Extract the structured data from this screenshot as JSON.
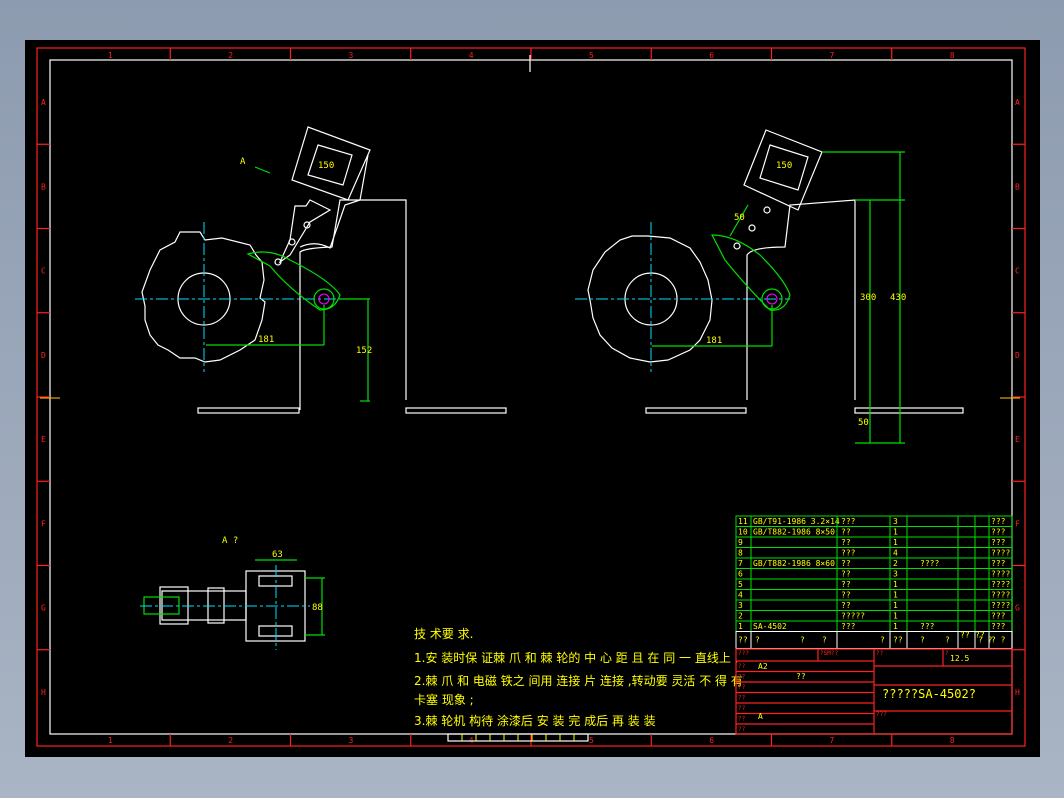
{
  "zones": {
    "cols": [
      "1",
      "2",
      "3",
      "4",
      "5",
      "6",
      "7",
      "8"
    ],
    "rows": [
      "A",
      "B",
      "C",
      "D",
      "E",
      "F",
      "G",
      "H"
    ]
  },
  "views": {
    "view_arrow_label": "A",
    "left_dims": {
      "horizontal": "181",
      "vertical": "152",
      "magnet": "150"
    },
    "right_dims": {
      "horizontal": "181",
      "link": "50",
      "vertical": "300",
      "overall": "430",
      "base": "50",
      "magnet": "150"
    },
    "view_a": {
      "title": "A ?",
      "width": "63",
      "height": "88"
    }
  },
  "notes": {
    "title": "技 术要 求.",
    "lines": [
      "1.安 装时保 证棘 爪 和 棘 轮的 中 心 距 且 在 同 一 直线上 ,",
      "2.棘 爪 和 电磁 铁之 间用 连接 片 连接 ,转动要 灵活 不 得 有",
      "卡塞 现象 ;",
      "3.棘 轮机 构待 涂漆后 安 装 完 成后 再 装 装"
    ]
  },
  "bom": {
    "rows": [
      {
        "no": "11",
        "code": "GB/T91-1986 3.2×14",
        "name": "???",
        "qty": "3",
        "mat": "",
        "note": "???"
      },
      {
        "no": "10",
        "code": "GB/T882-1986 8×50",
        "name": "??",
        "qty": "1",
        "mat": "",
        "note": "???"
      },
      {
        "no": "9",
        "code": "",
        "name": "??",
        "qty": "1",
        "mat": "",
        "note": "???"
      },
      {
        "no": "8",
        "code": "",
        "name": "???",
        "qty": "4",
        "mat": "",
        "note": "????"
      },
      {
        "no": "7",
        "code": "GB/T882-1986 8×60",
        "name": "??",
        "qty": "2",
        "mat": "????",
        "note": "???"
      },
      {
        "no": "6",
        "code": "",
        "name": "??",
        "qty": "3",
        "mat": "",
        "note": "????"
      },
      {
        "no": "5",
        "code": "",
        "name": "??",
        "qty": "1",
        "mat": "",
        "note": "????"
      },
      {
        "no": "4",
        "code": "",
        "name": "??",
        "qty": "1",
        "mat": "",
        "note": "????"
      },
      {
        "no": "3",
        "code": "",
        "name": "??",
        "qty": "1",
        "mat": "",
        "note": "????"
      },
      {
        "no": "2",
        "code": "",
        "name": "?????",
        "qty": "1",
        "mat": "",
        "note": "???"
      },
      {
        "no": "1",
        "code": "SA-4502",
        "name": "???",
        "qty": "1",
        "mat": "???",
        "note": "???"
      }
    ],
    "header": [
      "??",
      "?",
      "?",
      "?",
      "?",
      "??",
      "?",
      "?",
      "??",
      "??",
      "? ?",
      "? ?"
    ]
  },
  "title_block": {
    "labels": [
      "???",
      "?SM??",
      "??",
      "?",
      "??",
      "??",
      "??",
      "??",
      "??",
      "??",
      "??",
      "???"
    ],
    "size": "A2",
    "drawer": "??",
    "scale": "12.5",
    "revision": "A",
    "drawing_title": "?????SA-4502?"
  }
}
